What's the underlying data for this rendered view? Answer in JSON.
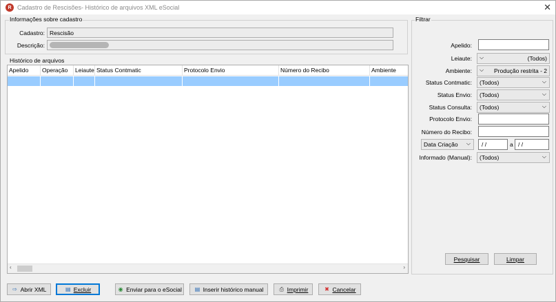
{
  "window": {
    "title": "Cadastro de Rescisões- Histórico de arquivos XML eSocial",
    "icon_letter": "R"
  },
  "info_group": {
    "title": "Informações sobre cadastro",
    "cadastro_label": "Cadastro:",
    "cadastro_value": "Rescisão",
    "descricao_label": "Descrição:"
  },
  "history_group": {
    "title": "Histórico de arquivos",
    "columns": [
      "Apelido",
      "Operação",
      "Leiaute",
      "Status Contmatic",
      "Protocolo Envio",
      "Número do Recibo",
      "Ambiente"
    ]
  },
  "filter": {
    "title": "Filtrar",
    "apelido_label": "Apelido:",
    "leiaute_label": "Leiaute:",
    "leiaute_value": "(Todos)",
    "ambiente_label": "Ambiente:",
    "ambiente_value": "Produção restrita - 2",
    "status_contmatic_label": "Status Contmatic:",
    "status_contmatic_value": "(Todos)",
    "status_envio_label": "Status Envio:",
    "status_envio_value": "(Todos)",
    "status_consulta_label": "Status Consulta:",
    "status_consulta_value": "(Todos)",
    "protocolo_label": "Protocolo Envio:",
    "recibo_label": "Número do Recibo:",
    "data_select_value": "Data Criação",
    "date_from": "/ /",
    "date_sep": "a",
    "date_to": "/ /",
    "informado_label": "Informado (Manual):",
    "informado_value": "(Todos)",
    "pesquisar": "Pesquisar",
    "limpar": "Limpar"
  },
  "toolbar": {
    "abrir_xml": "Abrir XML",
    "excluir": "Excluir",
    "enviar": "Enviar para o eSocial",
    "inserir": "Inserir histórico manual",
    "imprimir": "Imprimir",
    "cancelar": "Cancelar"
  },
  "colors": {
    "selected_row": "#99ccff",
    "focus_border": "#0078d7",
    "app_icon": "#c0392b"
  }
}
